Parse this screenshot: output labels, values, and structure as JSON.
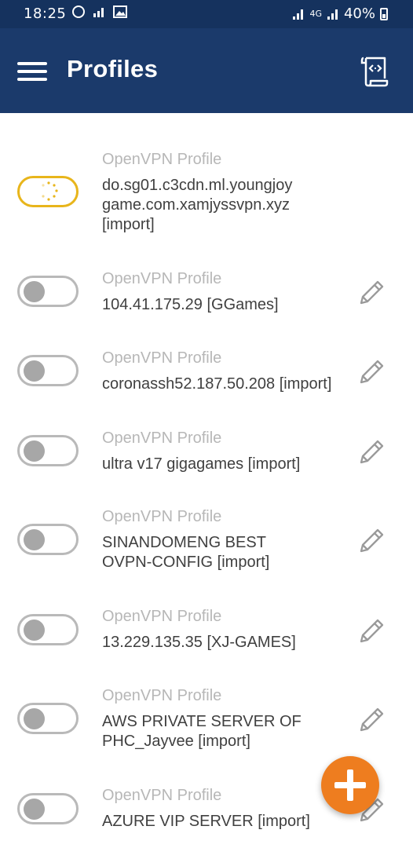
{
  "status_bar": {
    "time": "18:25",
    "network_label": "4G",
    "battery": "40%"
  },
  "app_bar": {
    "title": "Profiles"
  },
  "profiles": [
    {
      "type": "OpenVPN Profile",
      "name": "do.sg01.c3cdn.ml.youngjoy game.com.xamjyssvpn.xyz [import]",
      "state": "connecting"
    },
    {
      "type": "OpenVPN Profile",
      "name": "104.41.175.29 [GGames]",
      "state": "off"
    },
    {
      "type": "OpenVPN Profile",
      "name": "coronassh52.187.50.208 [import]",
      "state": "off"
    },
    {
      "type": "OpenVPN Profile",
      "name": "ultra v17 gigagames [import]",
      "state": "off"
    },
    {
      "type": "OpenVPN Profile",
      "name": "SINANDOMENG BEST OVPN-CONFIG [import]",
      "state": "off"
    },
    {
      "type": "OpenVPN Profile",
      "name": "13.229.135.35 [XJ-GAMES]",
      "state": "off"
    },
    {
      "type": "OpenVPN Profile",
      "name": "AWS PRIVATE SERVER OF PHC_Jayvee [import]",
      "state": "off"
    },
    {
      "type": "OpenVPN Profile",
      "name": "AZURE VIP SERVER [import]",
      "state": "off"
    }
  ],
  "colors": {
    "app_bar": "#1b3a6b",
    "fab": "#ee7d1f",
    "connecting": "#e8b51b"
  },
  "icons": {
    "menu": "hamburger-icon",
    "import": "import-file-icon",
    "edit": "pencil-icon",
    "add": "plus-icon"
  }
}
